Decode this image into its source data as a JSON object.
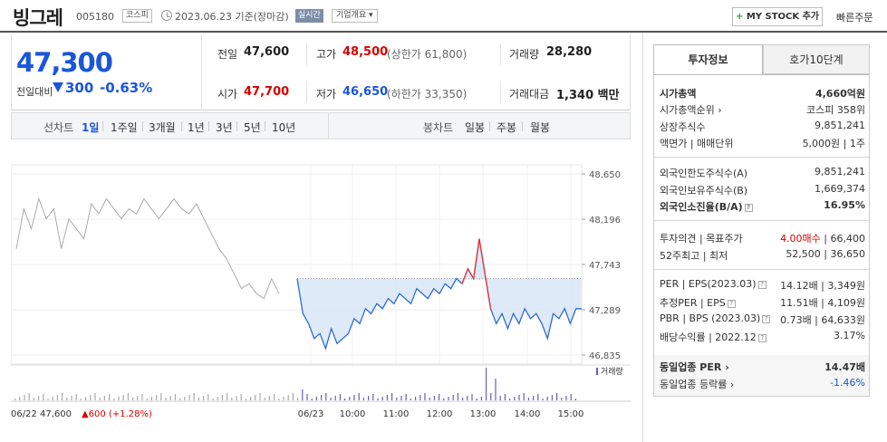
{
  "header": {
    "corp_name": "빙그레",
    "corp_code": "005180",
    "market": "코스피",
    "date_text": "2023.06.23  기준(장마감)",
    "realtime_label": "실시간",
    "overview_label": "기업개요 ▾",
    "mystock_label": "MY STOCK 추가",
    "quick_order_label": "빠른주문"
  },
  "price": {
    "current": "47,300",
    "change_label": "전일대비",
    "change": "300",
    "change_rate": "-0.63%",
    "prev_label": "전일",
    "prev": "47,600",
    "high_label": "고가",
    "high": "48,500",
    "upper_limit": "(상한가 61,800)",
    "volume_label": "거래량",
    "volume": "28,280",
    "open_label": "시가",
    "open": "47,700",
    "low_label": "저가",
    "low": "46,650",
    "lower_limit": "(하한가 33,350)",
    "amount_label": "거래대금",
    "amount": "1,340 백만"
  },
  "period_bar": {
    "line_label": "선차트",
    "periods": [
      "1일",
      "1주일",
      "3개월",
      "1년",
      "3년",
      "5년",
      "10년"
    ],
    "selected": "1일",
    "candle_label": "봉차트",
    "candles": [
      "일봉",
      "주봉",
      "월봉"
    ]
  },
  "chart_data": {
    "type": "line",
    "y_ticks": [
      "48,650",
      "48,196",
      "47,743",
      "47,289",
      "46,835"
    ],
    "ylim": [
      46835,
      48650
    ],
    "x_ticks": [
      "06/23",
      "10:00",
      "11:00",
      "12:00",
      "13:00",
      "14:00",
      "15:00"
    ],
    "reference_price": 47600,
    "volume_legend": "거래량",
    "footer_text": "06/22  47,600",
    "footer_change": "▲600 (+1.28%)",
    "prev_day": [
      47900,
      48300,
      48100,
      48400,
      48200,
      48300,
      47900,
      48200,
      48100,
      48000,
      48350,
      48250,
      48400,
      48300,
      48200,
      48300,
      48250,
      48400,
      48300,
      48200,
      48300,
      48400,
      48300,
      48250,
      48350,
      48200,
      48050,
      47900,
      47800,
      47650,
      47500,
      47550,
      47450,
      47400,
      47600,
      47450
    ],
    "today": [
      47600,
      47250,
      47150,
      47000,
      47050,
      46900,
      47100,
      46950,
      47000,
      47050,
      47200,
      47150,
      47300,
      47250,
      47350,
      47300,
      47400,
      47350,
      47450,
      47400,
      47350,
      47500,
      47450,
      47400,
      47500,
      47450,
      47550,
      47500,
      47600,
      47550,
      47700,
      47600,
      48000,
      47650,
      47300,
      47150,
      47250,
      47100,
      47250,
      47150,
      47300,
      47200,
      47250,
      47150,
      47000,
      47250,
      47200,
      47300,
      47150,
      47300,
      47300
    ]
  },
  "invest_info": {
    "tab1": "투자정보",
    "tab2": "호가10단계",
    "market_cap_label": "시가총액",
    "market_cap": "4,660억원",
    "rank_label": "시가총액순위",
    "rank": "코스피 358위",
    "shares_label": "상장주식수",
    "shares": "9,851,241",
    "face_label": "액면가 | 매매단위",
    "face": "5,000원 | 1주",
    "foreign_limit_label": "외국인한도주식수(A)",
    "foreign_limit": "9,851,241",
    "foreign_hold_label": "외국인보유주식수(B)",
    "foreign_hold": "1,669,374",
    "foreign_ratio_label": "외국인소진율(B/A)",
    "foreign_ratio": "16.95%",
    "opinion_label": "투자의견 | 목표주가",
    "opinion": "4.00매수",
    "target": "| 66,400",
    "week52_label": "52주최고 | 최저",
    "week52": "52,500 | 36,650",
    "per_label": "PER | EPS(2023.03)",
    "per": "14.12배 | 3,349원",
    "est_per_label": "추정PER | EPS",
    "est_per": "11.51배 | 4,109원",
    "pbr_label": "PBR | BPS (2023.03)",
    "pbr": "0.73배 | 64,633원",
    "div_label": "배당수익률 | 2022.12",
    "div": "3.17%",
    "sector_per_label": "동일업종 PER",
    "sector_per": "14.47배",
    "sector_rate_label": "동일업종 등락률",
    "sector_rate": "-1.46%"
  }
}
